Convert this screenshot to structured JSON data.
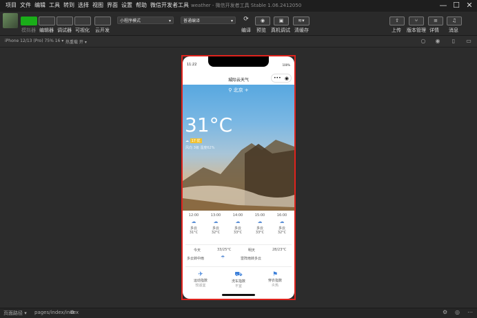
{
  "menubar": {
    "items": [
      "项目",
      "文件",
      "编辑",
      "工具",
      "转到",
      "选择",
      "视图",
      "界面",
      "设置",
      "帮助",
      "微信开发者工具"
    ],
    "window_title": "weather - 微信开发者工具 Stable 1.06.2412050"
  },
  "toolbar": {
    "buttons": [
      "模拟器",
      "编辑器",
      "调试器",
      "可视化",
      "云开发"
    ],
    "mode_select": "小程序模式",
    "compile_select": "普通编译",
    "actions": [
      "编译",
      "预览",
      "真机调试",
      "清缓存"
    ],
    "right_actions": [
      "上传",
      "版本管理",
      "详情",
      "消息"
    ]
  },
  "subbar": {
    "device": "iPhone 12/13 (Pro) 75% 16 ▾",
    "hot_reload": "热重载 开 ▾"
  },
  "statusbar": {
    "path_label": "页面路径 ▾",
    "path": "pages/index/index"
  },
  "phone": {
    "time": "11:22",
    "battery": "100%",
    "nav_title": "城际云天气",
    "capsule": "•••  ◉",
    "city": "北京",
    "temperature": "31°C",
    "air_quality": "17 优",
    "humidity": "风向 3级 湿度62%",
    "hourly": [
      {
        "time": "12:00",
        "cond": "多云",
        "temp": "31°C"
      },
      {
        "time": "13:00",
        "cond": "多云",
        "temp": "32°C"
      },
      {
        "time": "14:00",
        "cond": "多云",
        "temp": "33°C"
      },
      {
        "time": "15:00",
        "cond": "多云",
        "temp": "33°C"
      },
      {
        "time": "16:00",
        "cond": "多云",
        "temp": "32°C"
      }
    ],
    "daily": {
      "today_label": "今天",
      "today_range": "33/25°C",
      "today_desc": "多云转中雨",
      "tomorrow_label": "明天",
      "tomorrow_range": "28/23°C",
      "tomorrow_desc": "雷阵雨转多云"
    },
    "indices": [
      {
        "name": "运动指数",
        "value": "较适宜"
      },
      {
        "name": "洗车指数",
        "value": "不宜"
      },
      {
        "name": "穿衣指数",
        "value": "炎热"
      }
    ]
  }
}
